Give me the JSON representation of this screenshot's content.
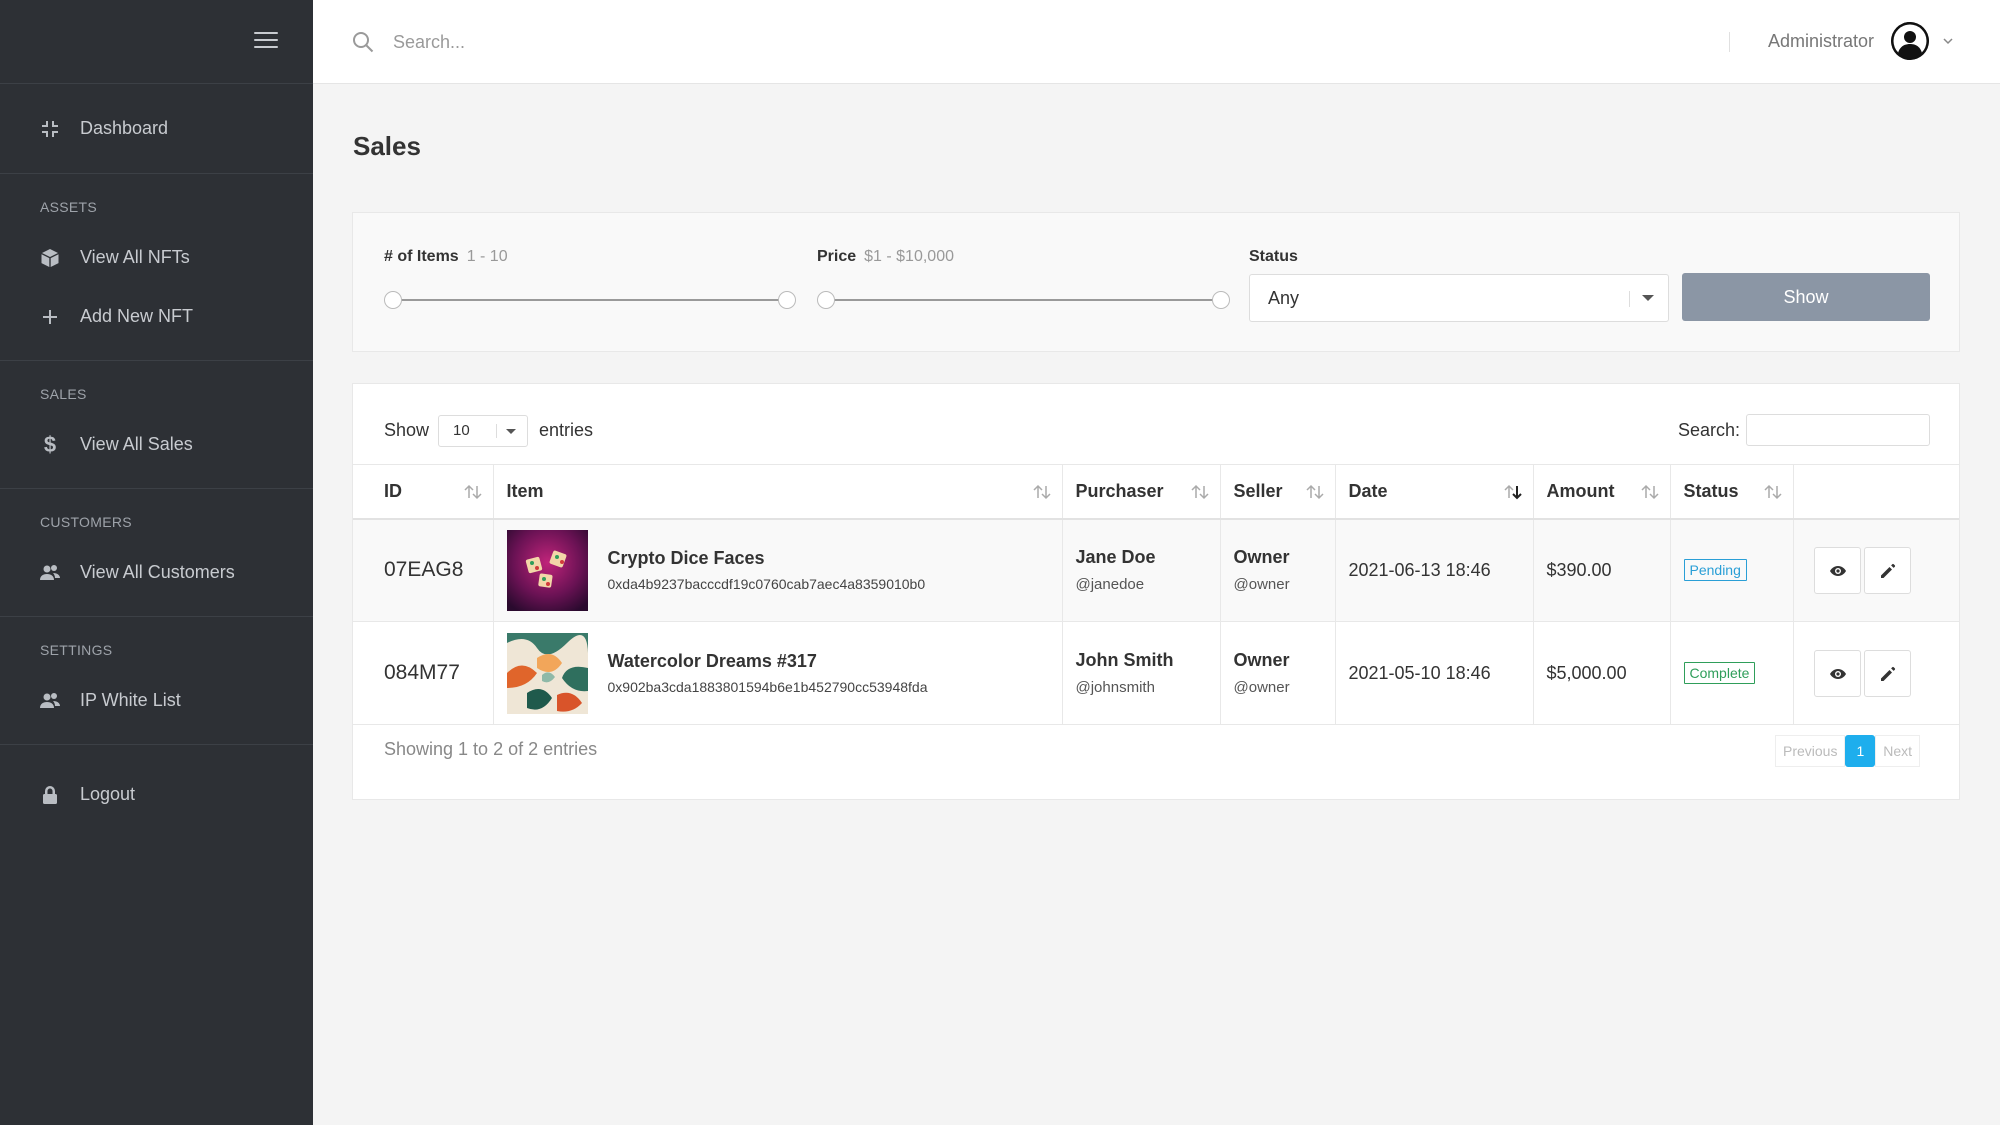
{
  "sidebar": {
    "items": [
      {
        "label": "Dashboard",
        "icon": "dashboard-icon"
      },
      {
        "label": "View All NFTs",
        "icon": "cube-icon"
      },
      {
        "label": "Add New NFT",
        "icon": "plus-icon"
      },
      {
        "label": "View All Sales",
        "icon": "dollar-icon"
      },
      {
        "label": "View All Customers",
        "icon": "users-icon"
      },
      {
        "label": "IP White List",
        "icon": "users-icon"
      },
      {
        "label": "Logout",
        "icon": "lock-icon"
      }
    ],
    "headings": {
      "assets": "ASSETS",
      "sales": "SALES",
      "customers": "CUSTOMERS",
      "settings": "SETTINGS"
    }
  },
  "header": {
    "search_placeholder": "Search...",
    "user_name": "Administrator"
  },
  "page": {
    "title": "Sales"
  },
  "filters": {
    "items_label": "# of Items",
    "items_range": "1 - 10",
    "price_label": "Price",
    "price_range": "$1 - $10,000",
    "status_label": "Status",
    "status_value": "Any",
    "show_button": "Show"
  },
  "table_controls": {
    "show_label": "Show",
    "page_length": "10",
    "entries_label": "entries",
    "search_label": "Search:"
  },
  "table": {
    "columns": [
      "ID",
      "Item",
      "Purchaser",
      "Seller",
      "Date",
      "Amount",
      "Status"
    ],
    "rows": [
      {
        "id": "07EAG8",
        "item_title": "Crypto Dice Faces",
        "item_hash": "0xda4b9237bacccdf19c0760cab7aec4a8359010b0",
        "purchaser_name": "Jane Doe",
        "purchaser_handle": "@janedoe",
        "seller_name": "Owner",
        "seller_handle": "@owner",
        "date": "2021-06-13 18:46",
        "amount": "$390.00",
        "status": "Pending"
      },
      {
        "id": "084M77",
        "item_title": "Watercolor Dreams #317",
        "item_hash": "0x902ba3cda1883801594b6e1b452790cc53948fda",
        "purchaser_name": "John Smith",
        "purchaser_handle": "@johnsmith",
        "seller_name": "Owner",
        "seller_handle": "@owner",
        "date": "2021-05-10 18:46",
        "amount": "$5,000.00",
        "status": "Complete"
      }
    ]
  },
  "footer": {
    "info": "Showing 1 to 2 of 2 entries",
    "previous": "Previous",
    "current_page": "1",
    "next": "Next"
  },
  "colors": {
    "sidebar_bg": "#2d3035",
    "accent": "#1eaeed",
    "show_button_bg": "#8b96a5",
    "pending": "#2a9fd6",
    "complete": "#2f9e5a"
  }
}
